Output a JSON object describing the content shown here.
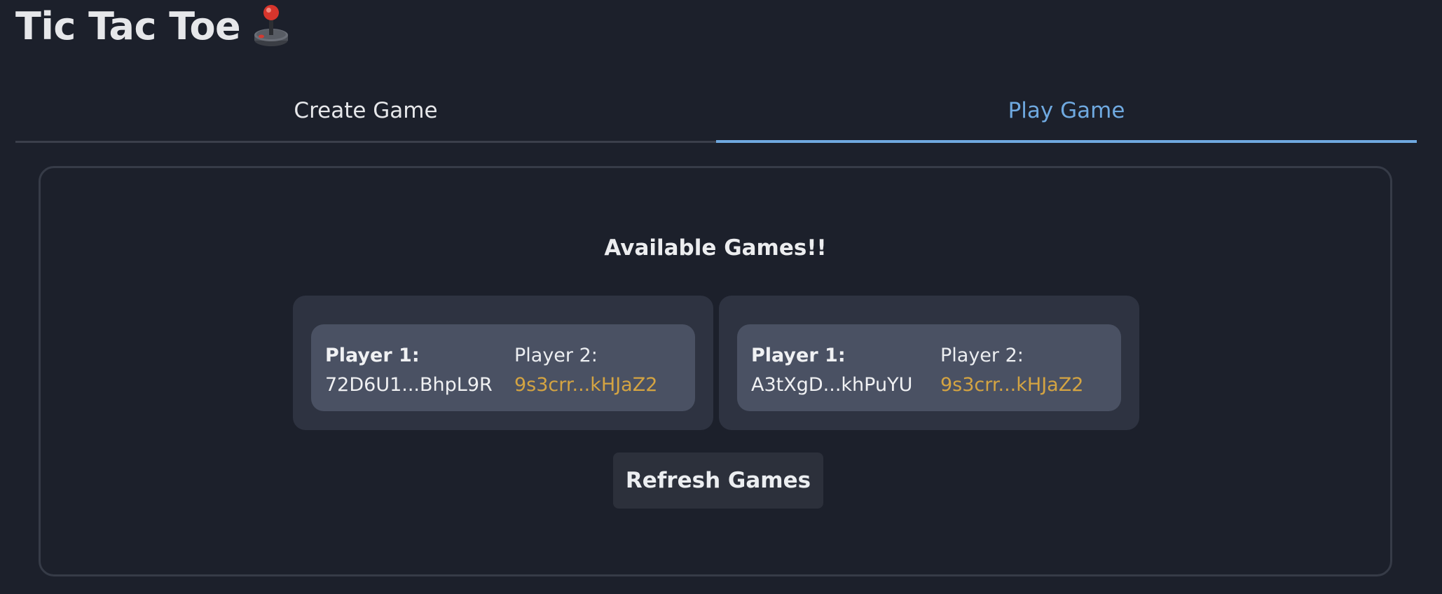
{
  "header": {
    "title": "Tic Tac Toe",
    "icon": "joystick-icon"
  },
  "tabs": [
    {
      "label": "Create Game",
      "active": false
    },
    {
      "label": "Play Game",
      "active": true
    }
  ],
  "panel": {
    "heading": "Available Games!!",
    "games": [
      {
        "player1_label": "Player 1:",
        "player1_address": "72D6U1...BhpL9R",
        "player2_label": "Player 2:",
        "player2_address": "9s3crr...kHJaZ2"
      },
      {
        "player1_label": "Player 1:",
        "player1_address": "A3tXgD...khPuYU",
        "player2_label": "Player 2:",
        "player2_address": "9s3crr...kHJaZ2"
      }
    ],
    "refresh_label": "Refresh Games"
  },
  "colors": {
    "background": "#1c202b",
    "accent": "#6fa9e0",
    "player2_address": "#d4a442",
    "card": "#2e3341",
    "card_inner": "#4a5163"
  }
}
